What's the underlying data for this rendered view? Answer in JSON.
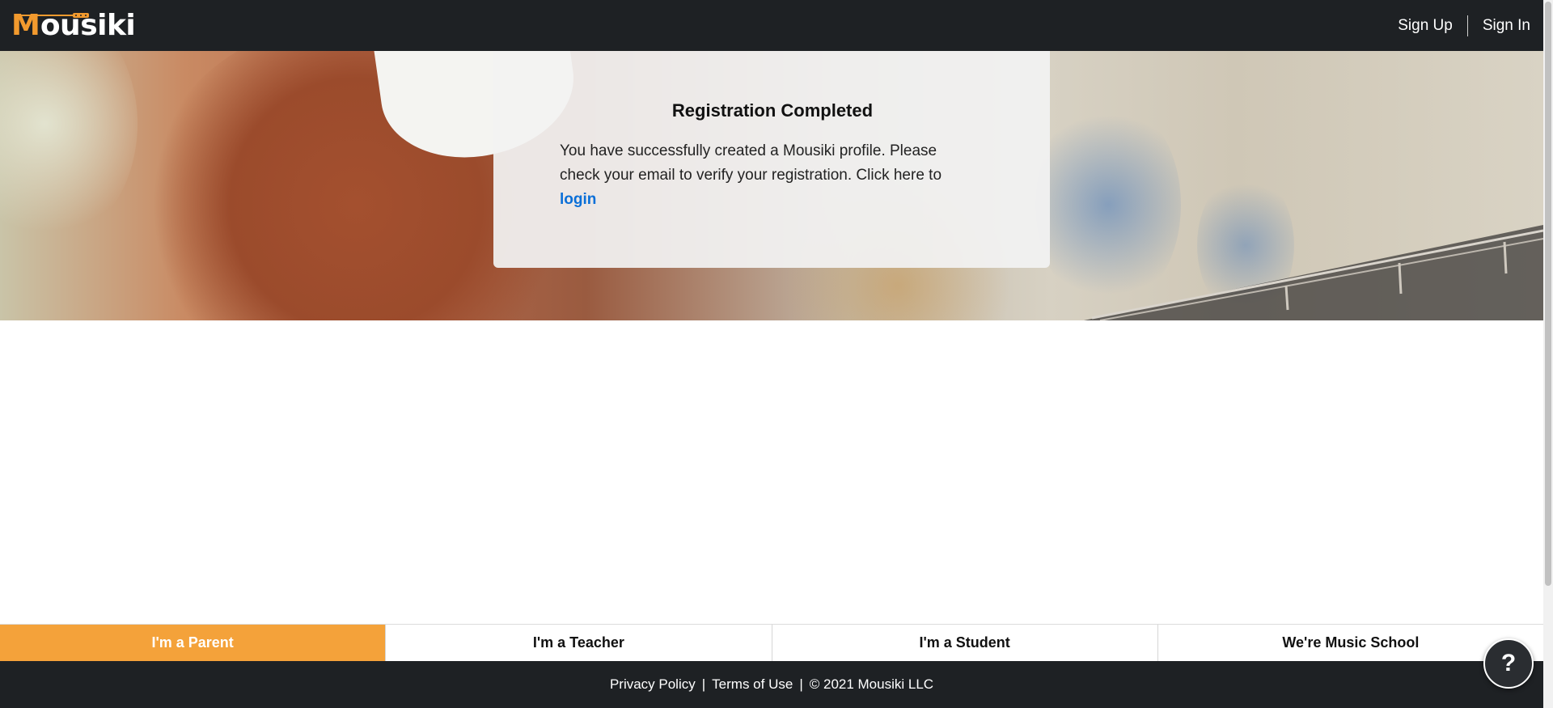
{
  "header": {
    "logo_text_initial": "M",
    "logo_text_rest": "ousiki",
    "signup_label": "Sign Up",
    "signin_label": "Sign In"
  },
  "registration": {
    "title": "Registration Completed",
    "message": "You have successfully created a Mousiki profile. Please check your email to verify your registration. Click here to",
    "login_label": "login"
  },
  "role_tabs": [
    {
      "label": "I'm a Parent",
      "active": true
    },
    {
      "label": "I'm a Teacher",
      "active": false
    },
    {
      "label": "I'm a Student",
      "active": false
    },
    {
      "label": "We're Music School",
      "active": false
    }
  ],
  "footer": {
    "privacy_label": "Privacy Policy",
    "terms_label": "Terms of Use",
    "separator": "|",
    "copyright": "© 2021 Mousiki LLC"
  },
  "help": {
    "label": "?"
  },
  "colors": {
    "brand_orange": "#f4a23a",
    "navbar_bg": "#1e2124",
    "link_blue": "#0a6fd8"
  }
}
